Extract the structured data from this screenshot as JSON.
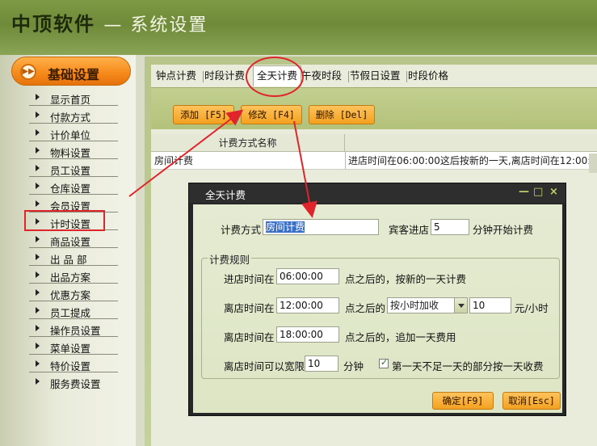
{
  "header": {
    "brand": "中顶软件",
    "separator": "—",
    "section": "系统设置"
  },
  "sidebar": {
    "heading": "基础设置",
    "items": [
      {
        "label": "显示首页"
      },
      {
        "label": "付款方式"
      },
      {
        "label": "计价单位"
      },
      {
        "label": "物料设置"
      },
      {
        "label": "员工设置"
      },
      {
        "label": "仓库设置"
      },
      {
        "label": "会员设置"
      },
      {
        "label": "计时设置"
      },
      {
        "label": "商品设置"
      },
      {
        "label": "出 品 部"
      },
      {
        "label": "出品方案"
      },
      {
        "label": "优惠方案"
      },
      {
        "label": "员工提成"
      },
      {
        "label": "操作员设置"
      },
      {
        "label": "菜单设置"
      },
      {
        "label": "特价设置"
      },
      {
        "label": "服务费设置"
      }
    ],
    "highlighted": "计时设置"
  },
  "tabs": [
    "钟点计费",
    "时段计费",
    "全天计费",
    "午夜时段",
    "节假日设置",
    "时段价格"
  ],
  "active_tab": "全天计费",
  "toolbar": {
    "add": "添加 [F5]",
    "edit": "修改 [F4]",
    "delete": "删除 [Del]"
  },
  "grid": {
    "headers": [
      "计费方式名称"
    ],
    "rows": [
      {
        "name": "房间计费",
        "desc": "进店时间在06:00:00这后按新的一天,离店时间在12:00:00"
      }
    ]
  },
  "dialog": {
    "title": "全天计费",
    "controls": {
      "min": "—",
      "max": "□",
      "close": "×"
    },
    "billing_method_label": "计费方式",
    "billing_method_value": "房间计费",
    "guest_label": "宾客进店",
    "guest_minutes": "5",
    "guest_suffix": "分钟开始计费",
    "rules_legend": "计费规则",
    "rule1_label": "进店时间在",
    "rule1_time": "06:00:00",
    "rule1_suffix": "点之后的，按新的一天计费",
    "rule2_label": "离店时间在",
    "rule2_time": "12:00:00",
    "rule2_mid": "点之后的",
    "rule2_mode": "按小时加收",
    "rule2_rate": "10",
    "rule2_unit": "元/小时",
    "rule3_label": "离店时间在",
    "rule3_time": "18:00:00",
    "rule3_suffix": "点之后的，追加一天费用",
    "grace_label": "离店时间可以宽限",
    "grace_value": "10",
    "grace_unit": "分钟",
    "first_day_label": "第一天不足一天的部分按一天收费",
    "first_day_checked": true,
    "ok": "确定[F9]",
    "cancel": "取消[Esc]"
  },
  "colors": {
    "accent": "#f3a11f",
    "annotation": "#e0242c",
    "header": "#6f8a39"
  }
}
